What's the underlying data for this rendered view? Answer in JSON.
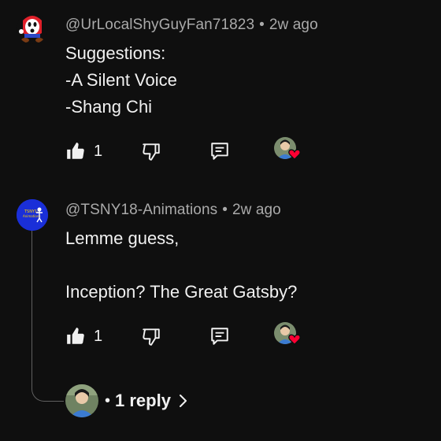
{
  "comments": [
    {
      "handle": "@UrLocalShyGuyFan71823",
      "time": "2w ago",
      "text": "Suggestions:\n-A Silent Voice\n-Shang Chi",
      "likes": "1",
      "creator_heart": true
    },
    {
      "handle": "@TSNY18-Animations",
      "time": "2w ago",
      "text": "Lemme guess,\n\nInception? The Great Gatsby?",
      "likes": "1",
      "creator_heart": true
    }
  ],
  "replies": {
    "bullet": "•",
    "label": "1 reply"
  },
  "separator": "•",
  "colors": {
    "background": "#0f0f0f",
    "meta": "#aaaaaa",
    "text": "#f1f1f1",
    "heart": "#ff0033",
    "thread_line": "#606060"
  },
  "icons": [
    "like-icon",
    "dislike-icon",
    "reply-icon",
    "creator-heart-icon",
    "chevron-right-icon"
  ]
}
